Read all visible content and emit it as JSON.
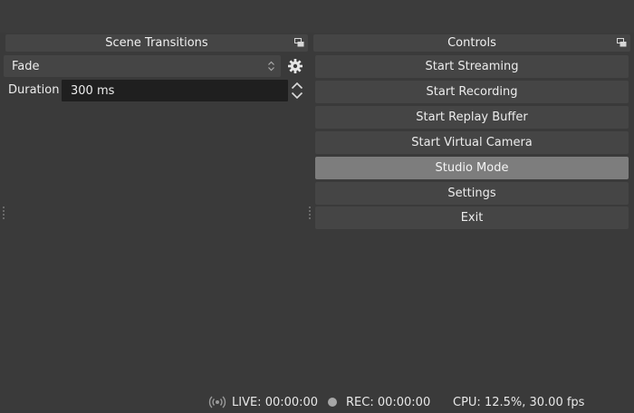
{
  "scene_transitions": {
    "title": "Scene Transitions",
    "transition_value": "Fade",
    "duration_label": "Duration",
    "duration_value": "300 ms"
  },
  "controls": {
    "title": "Controls",
    "buttons": [
      {
        "label": "Start Streaming",
        "active": false
      },
      {
        "label": "Start Recording",
        "active": false
      },
      {
        "label": "Start Replay Buffer",
        "active": false
      },
      {
        "label": "Start Virtual Camera",
        "active": false
      },
      {
        "label": "Studio Mode",
        "active": true
      },
      {
        "label": "Settings",
        "active": false
      },
      {
        "label": "Exit",
        "active": false
      }
    ]
  },
  "status_bar": {
    "live": "LIVE: 00:00:00",
    "rec": "REC: 00:00:00",
    "cpu": "CPU: 12.5%, 30.00 fps"
  },
  "icons": {
    "float": "float-dock-icon",
    "gear": "gear-icon",
    "select_arrows": "updown-icon",
    "spin": "spinbox-icon",
    "live": "broadcast-icon",
    "rec": "record-dot-icon"
  },
  "colors": {
    "background": "#3a3a3a",
    "panel": "#454545",
    "input": "#1f1f1f",
    "active_button": "#7d7d7d",
    "text": "#ececec"
  }
}
